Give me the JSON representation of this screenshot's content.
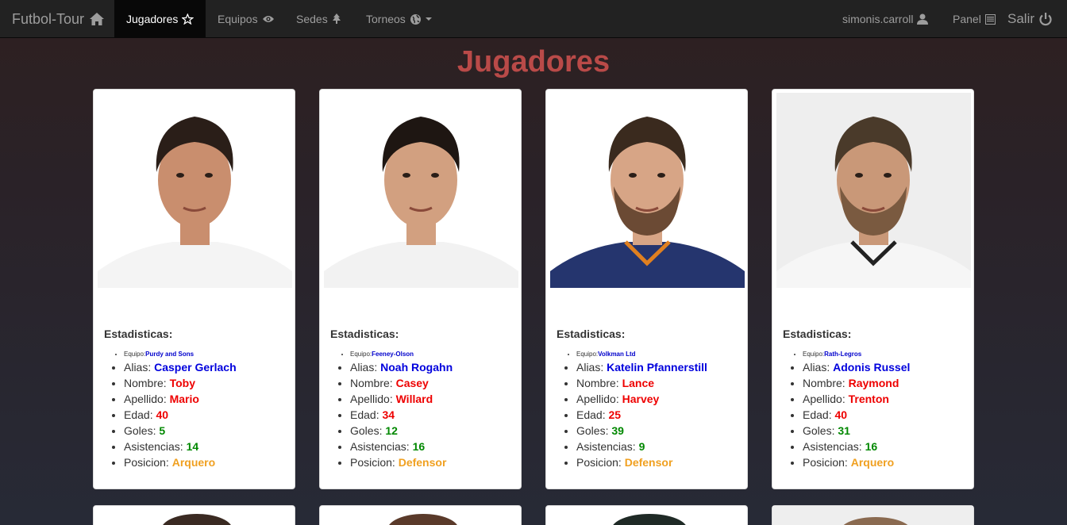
{
  "navbar": {
    "brand": "Futbol-Tour",
    "items": [
      {
        "label": "Jugadores",
        "icon": "star-icon",
        "active": true
      },
      {
        "label": "Equipos",
        "icon": "eye-icon",
        "active": false
      },
      {
        "label": "Sedes",
        "icon": "tree-icon",
        "active": false
      },
      {
        "label": "Torneos",
        "icon": "globe-icon",
        "active": false
      }
    ],
    "user": "simonis.carroll",
    "panel": "Panel",
    "logout": "Salir"
  },
  "page": {
    "title": "Jugadores",
    "stats_title": "Estadisticas:"
  },
  "labels": {
    "equipo": "Equipo:",
    "alias": "Alias:",
    "nombre": "Nombre:",
    "apellido": "Apellido:",
    "edad": "Edad:",
    "goles": "Goles:",
    "asistencias": "Asistencias:",
    "posicion": "Posicion:"
  },
  "players": [
    {
      "equipo": "Purdy and Sons",
      "alias": "Casper Gerlach",
      "nombre": "Toby",
      "apellido": "Mario",
      "edad": "40",
      "goles": "5",
      "asistencias": "14",
      "posicion": "Arquero"
    },
    {
      "equipo": "Feeney-Olson",
      "alias": "Noah Rogahn",
      "nombre": "Casey",
      "apellido": "Willard",
      "edad": "34",
      "goles": "12",
      "asistencias": "16",
      "posicion": "Defensor"
    },
    {
      "equipo": "Volkman Ltd",
      "alias": "Katelin Pfannerstill",
      "nombre": "Lance",
      "apellido": "Harvey",
      "edad": "25",
      "goles": "39",
      "asistencias": "9",
      "posicion": "Defensor"
    },
    {
      "equipo": "Rath-Legros",
      "alias": "Adonis Russel",
      "nombre": "Raymond",
      "apellido": "Trenton",
      "edad": "40",
      "goles": "31",
      "asistencias": "16",
      "posicion": "Arquero"
    }
  ],
  "colors": {
    "title": "#b94a48",
    "alias": "#0000dd",
    "name": "#ee0000",
    "stat": "#008800",
    "position": "#f0a020"
  }
}
